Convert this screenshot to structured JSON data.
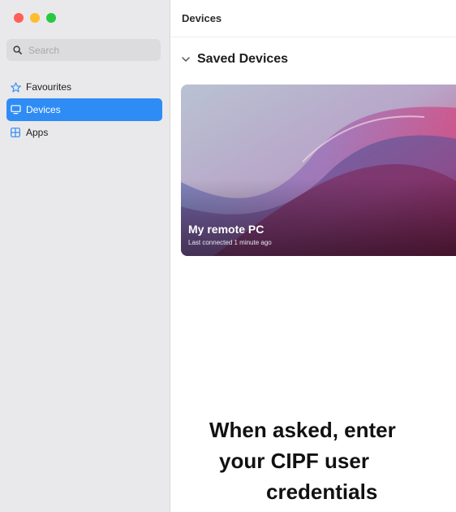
{
  "traffic_lights": {
    "close": "#ff5f57",
    "minimize": "#febc2e",
    "zoom": "#28c840"
  },
  "sidebar": {
    "search_placeholder": "Search",
    "items": [
      {
        "label": "Favourites",
        "icon": "star-icon",
        "active": false
      },
      {
        "label": "Devices",
        "icon": "monitor-icon",
        "active": true
      },
      {
        "label": "Apps",
        "icon": "apps-grid-icon",
        "active": false
      }
    ]
  },
  "main": {
    "title": "Devices",
    "section_label": "Saved Devices",
    "device_card": {
      "name": "My remote PC",
      "status": "Last connected 1 minute ago"
    }
  },
  "caption": {
    "line1": "When asked, enter",
    "line2": "your CIPF user",
    "line3": "credentials"
  },
  "colors": {
    "accent": "#2f8cf5",
    "sidebar_bg": "#e9e9eb"
  }
}
